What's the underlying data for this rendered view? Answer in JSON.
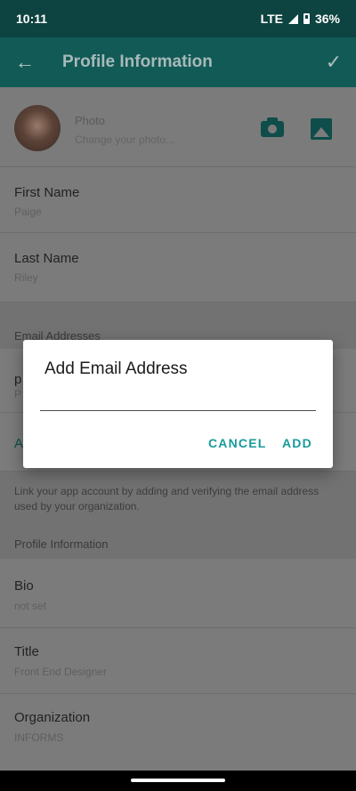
{
  "status_bar": {
    "time": "10:11",
    "network": "LTE",
    "battery": "36%"
  },
  "app_bar": {
    "back_icon": "arrow-left-icon",
    "title": "Profile Information",
    "confirm_icon": "check-icon"
  },
  "photo": {
    "title": "Photo",
    "subtitle": "Change your photo..."
  },
  "fields": {
    "first_name": {
      "label": "First Name",
      "value": "Paige"
    },
    "last_name": {
      "label": "Last Name",
      "value": "Riley"
    }
  },
  "email_section": {
    "header": "Email Addresses",
    "row_partial_label": "p",
    "row_partial_value": "P",
    "add_partial": "A",
    "helper_text": "Link your app account by adding and verifying the email address used by your organization."
  },
  "profile_section": {
    "header": "Profile Information",
    "bio": {
      "label": "Bio",
      "value": "not set"
    },
    "title": {
      "label": "Title",
      "value": "Front End Designer"
    },
    "organization": {
      "label": "Organization",
      "value": "INFORMS"
    }
  },
  "dialog": {
    "title": "Add Email Address",
    "input_value": "",
    "cancel_label": "CANCEL",
    "add_label": "ADD"
  },
  "colors": {
    "app_bar": "#115a56",
    "accent": "#1a9a9a"
  }
}
